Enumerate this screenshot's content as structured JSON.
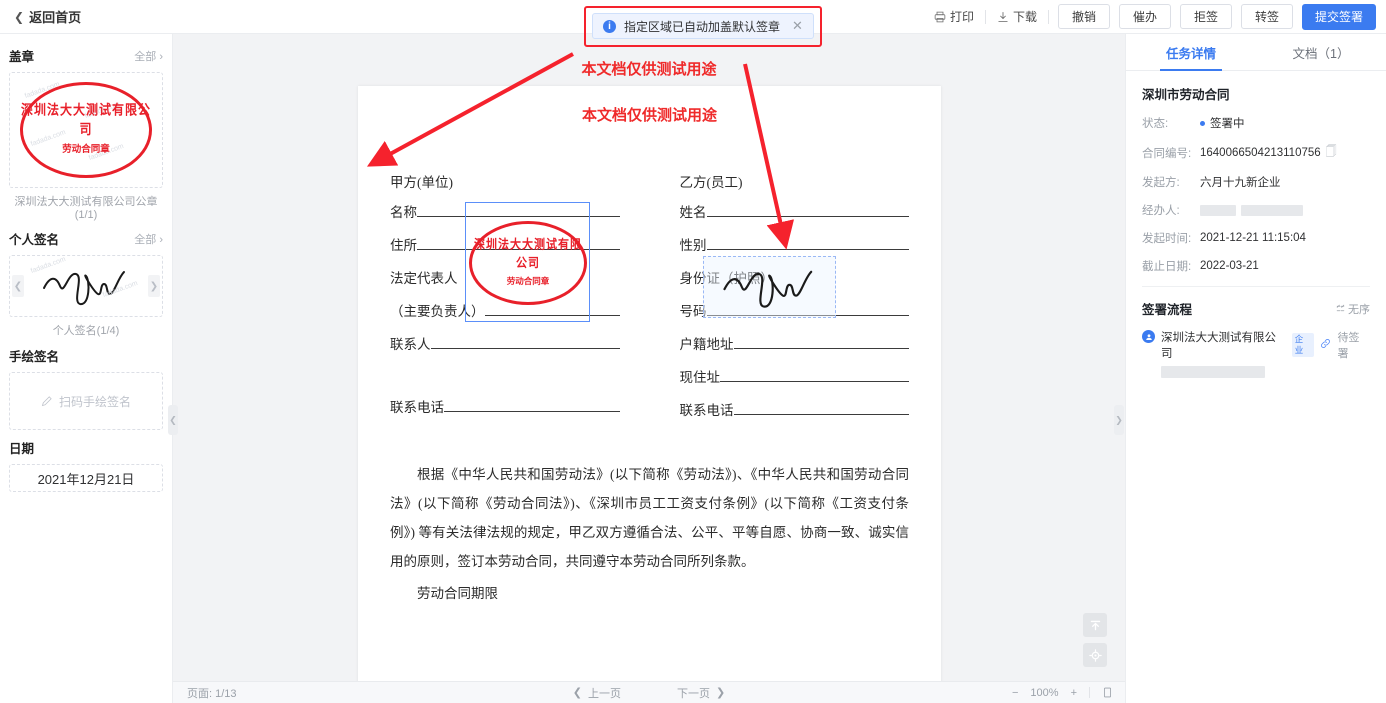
{
  "topbar": {
    "back_label": "返回首页",
    "back_icon": "chevron-left-icon",
    "print_label": "打印",
    "print_icon": "printer-icon",
    "download_label": "下载",
    "download_icon": "download-icon",
    "buttons": [
      {
        "label": "撤销"
      },
      {
        "label": "催办"
      },
      {
        "label": "拒签"
      },
      {
        "label": "转签"
      }
    ],
    "primary_label": "提交签署",
    "primary_color": "#3b7bf0"
  },
  "banner": {
    "icon": "info-icon",
    "text": "指定区域已自动加盖默认签章",
    "close_icon": "close-icon",
    "highlight_color": "#f5222d"
  },
  "sidebar": {
    "sections": [
      {
        "title": "盖章",
        "all_label": "全部",
        "caption": "深圳法大大测试有限公司公章(1/1)"
      },
      {
        "title": "个人签名",
        "all_label": "全部",
        "caption": "个人签名(1/4)"
      },
      {
        "title": "手绘签名",
        "placeholder": "扫码手绘签名",
        "icon": "pen-icon"
      },
      {
        "title": "日期",
        "value": "2021年12月21日"
      }
    ],
    "seal": {
      "top_text": "深圳法大大测试有限公司",
      "bottom_text": "劳动合同章",
      "color": "#e8202a",
      "watermark": "fadada.com"
    },
    "prev_icon": "chevron-left-icon",
    "next_icon": "chevron-right-icon",
    "collapse_icon": "chevron-left-icon"
  },
  "document": {
    "watermark_outside": "本文档仅供测试用途",
    "watermark_inside": "本文档仅供测试用途",
    "party_a_label": "甲方(单位)",
    "party_b_label": "乙方(员工)",
    "fields_a": [
      {
        "label": "名称",
        "line": true
      },
      {
        "label": "住所",
        "line": true
      },
      {
        "label": "法定代表人",
        "line": false
      },
      {
        "label": "（主要负责人）",
        "line": true
      },
      {
        "label": "联系人",
        "line": true
      },
      {
        "label": "",
        "line": false
      },
      {
        "label": "联系电话",
        "line": true
      }
    ],
    "fields_b": [
      {
        "label": "姓名",
        "line": true
      },
      {
        "label": "性别",
        "line": true
      },
      {
        "label": "身份证（护照）",
        "line": false
      },
      {
        "label": "号码",
        "line": true
      },
      {
        "label": "户籍地址",
        "line": true
      },
      {
        "label": "现住址",
        "line": true
      },
      {
        "label": "联系电话",
        "line": true
      }
    ],
    "paragraph": "根据《中华人民共和国劳动法》(以下简称《劳动法》)、《中华人民共和国劳动合同法》(以下简称《劳动合同法》)、《深圳市员工工资支付条例》(以下简称《工资支付条例》) 等有关法律法规的规定，甲乙双方遵循合法、公平、平等自愿、协商一致、诚实信用的原则，签订本劳动合同，共同遵守本劳动合同所列条款。",
    "paragraph_cut": "劳动合同期限",
    "scroll_top_icon": "scroll-to-top-icon",
    "locate_icon": "locate-icon"
  },
  "bottombar": {
    "page_label": "页面:",
    "page_value": "1/13",
    "prev_page": "上一页",
    "next_page": "下一页",
    "zoom_out_icon": "minus-icon",
    "zoom_value": "100%",
    "zoom_in_icon": "plus-icon",
    "fit_icon": "fit-page-icon"
  },
  "right_panel": {
    "tabs": [
      {
        "label": "任务详情",
        "active": true
      },
      {
        "label": "文档（1）",
        "active": false
      }
    ],
    "doc_title": "深圳市劳动合同",
    "details": [
      {
        "key": "状态:",
        "value": "签署中",
        "type": "status"
      },
      {
        "key": "合同编号:",
        "value": "1640066504213110756",
        "type": "copy"
      },
      {
        "key": "发起方:",
        "value": "六月十九新企业",
        "type": "text"
      },
      {
        "key": "经办人:",
        "value": "",
        "type": "redacted"
      },
      {
        "key": "发起时间:",
        "value": "2021-12-21 11:15:04",
        "type": "text"
      },
      {
        "key": "截止日期:",
        "value": "2022-03-21",
        "type": "text"
      }
    ],
    "flow_title": "签署流程",
    "flow_order": "无序",
    "flow_order_icon": "unordered-icon",
    "signer": {
      "name": "深圳法大大测试有限公司",
      "badge": "企业",
      "link_icon": "link-icon",
      "status": "待签署",
      "avatar_icon": "user-icon"
    },
    "copy_icon": "copy-icon"
  }
}
